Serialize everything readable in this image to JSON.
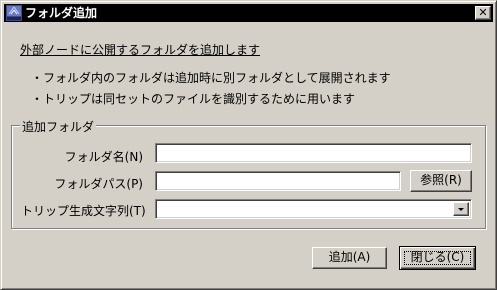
{
  "window": {
    "title": "フォルダ追加",
    "close_glyph": "✕"
  },
  "content": {
    "heading": "外部ノードに公開するフォルダを追加します",
    "bullets": [
      "・フォルダ内のフォルダは追加時に別フォルダとして展開されます",
      "・トリップは同セットのファイルを識別するために用います"
    ]
  },
  "group": {
    "legend": "追加フォルダ",
    "folder_name_label": "フォルダ名(N)",
    "folder_name_value": "",
    "folder_path_label": "フォルダパス(P)",
    "folder_path_value": "",
    "browse_label": "参照(R)",
    "trip_label": "トリップ生成文字列(T)",
    "trip_value": ""
  },
  "buttons": {
    "add": "追加(A)",
    "close": "閉じる(C)"
  },
  "icons": {
    "app": "app-icon",
    "close": "close-icon",
    "dropdown": "chevron-down-icon"
  }
}
